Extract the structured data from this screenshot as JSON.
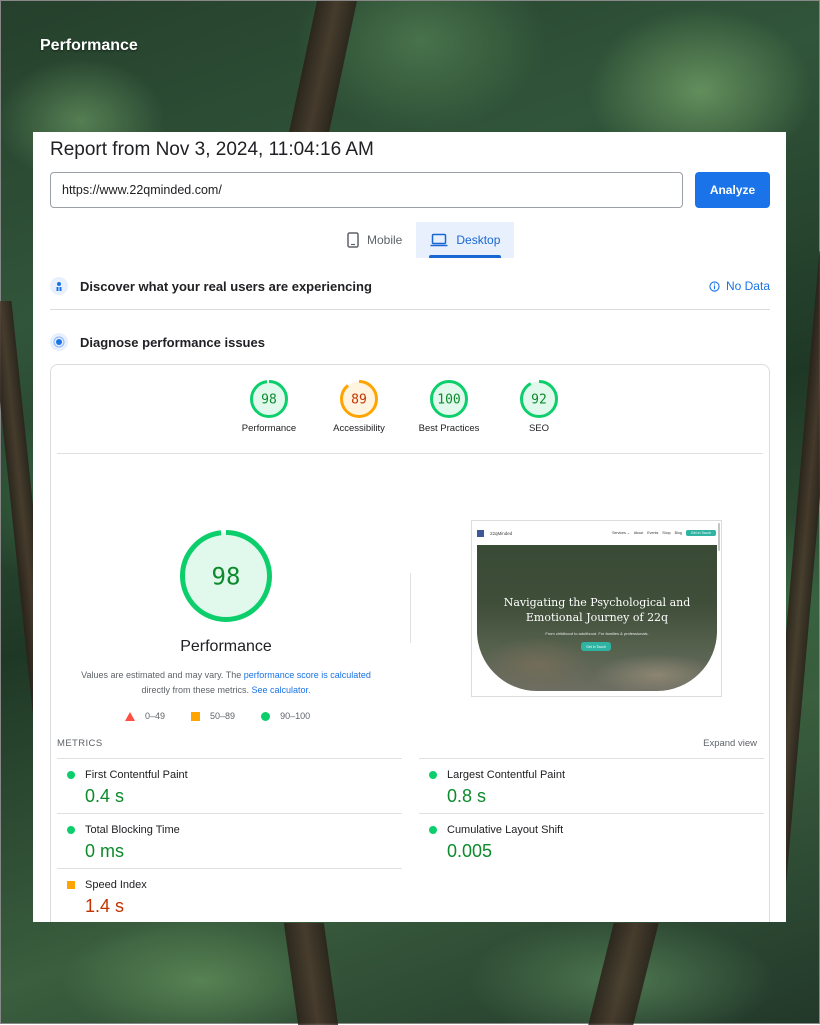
{
  "app_title": "Performance",
  "report": {
    "title": "Report from Nov 3, 2024, 11:04:16 AM",
    "url_value": "https://www.22qminded.com/",
    "analyze_label": "Analyze"
  },
  "tabs": [
    {
      "label": "Mobile",
      "icon": "phone-icon",
      "active": false
    },
    {
      "label": "Desktop",
      "icon": "laptop-icon",
      "active": true
    }
  ],
  "sections": {
    "real_users": {
      "label": "Discover what your real users are experiencing",
      "status": "No Data"
    },
    "diagnose": {
      "label": "Diagnose performance issues"
    }
  },
  "scores": [
    {
      "label": "Performance",
      "value": "98",
      "score": 98,
      "color": "#0cce6b",
      "text_color": "#0c8a2c"
    },
    {
      "label": "Accessibility",
      "value": "89",
      "score": 89,
      "color": "#ffa400",
      "text_color": "#c33300"
    },
    {
      "label": "Best Practices",
      "value": "100",
      "score": 100,
      "color": "#0cce6b",
      "text_color": "#0c8a2c"
    },
    {
      "label": "SEO",
      "value": "92",
      "score": 92,
      "color": "#0cce6b",
      "text_color": "#0c8a2c"
    }
  ],
  "main_score": {
    "value": "98",
    "score": 98,
    "label": "Performance",
    "color": "#0cce6b",
    "text_color": "#0c8a2c"
  },
  "note": {
    "prefix": "Values are estimated and may vary. The ",
    "link1": "performance score is calculated",
    "middle": "directly from these metrics. ",
    "link2": "See calculator."
  },
  "legend": [
    {
      "label": "0–49",
      "shape": "triangle",
      "color": "#ff4e42"
    },
    {
      "label": "50–89",
      "shape": "square",
      "color": "#ffa400"
    },
    {
      "label": "90–100",
      "shape": "circle",
      "color": "#0cce6b"
    }
  ],
  "screenshot": {
    "brand": "22qMinded",
    "nav": [
      "Services ⌄",
      "About",
      "Events",
      "Shop",
      "Blog"
    ],
    "nav_button": "Get in Touch",
    "headline": "Navigating the Psychological and Emotional Journey of 22q",
    "subtitle": "From childhood to adulthood. For families & professionals.",
    "cta": "Get in Touch"
  },
  "metrics_header": "METRICS",
  "expand_label": "Expand view",
  "metrics": [
    {
      "name": "First Contentful Paint",
      "value": "0.4 s",
      "status": "good"
    },
    {
      "name": "Largest Contentful Paint",
      "value": "0.8 s",
      "status": "good"
    },
    {
      "name": "Total Blocking Time",
      "value": "0 ms",
      "status": "good"
    },
    {
      "name": "Cumulative Layout Shift",
      "value": "0.005",
      "status": "good"
    },
    {
      "name": "Speed Index",
      "value": "1.4 s",
      "status": "average"
    }
  ],
  "colors": {
    "accent": "#1a73e8",
    "good": "#0cce6b",
    "average": "#ffa400",
    "poor": "#ff4e42"
  }
}
